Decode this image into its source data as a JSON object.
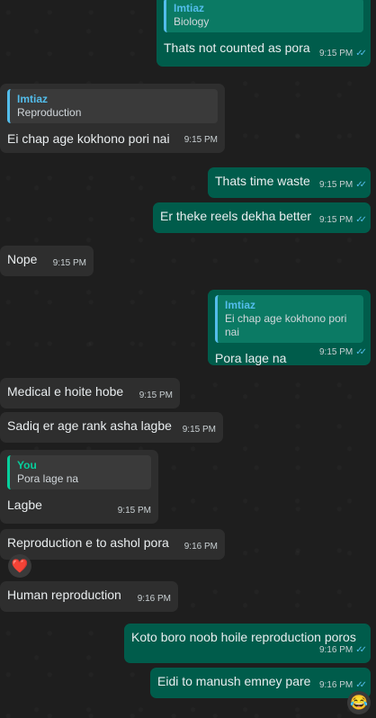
{
  "messages": [
    {
      "id": "m1",
      "dir": "out",
      "quote": {
        "name": "Imtiaz",
        "text": "Biology"
      },
      "text": "Thats not counted as pora",
      "time": "9:15 PM"
    },
    {
      "id": "m2",
      "dir": "in",
      "quote": {
        "name": "Imtiaz",
        "text": "Reproduction"
      },
      "text": "Ei chap age kokhono pori nai",
      "time": "9:15 PM"
    },
    {
      "id": "m3",
      "dir": "out",
      "text": "Thats time waste",
      "time": "9:15 PM"
    },
    {
      "id": "m4",
      "dir": "out",
      "text": "Er theke reels dekha better",
      "time": "9:15 PM"
    },
    {
      "id": "m5",
      "dir": "in",
      "text": "Nope",
      "time": "9:15 PM"
    },
    {
      "id": "m6",
      "dir": "out",
      "quote": {
        "name": "Imtiaz",
        "text": "Ei chap age kokhono pori nai"
      },
      "text": "Pora lage na",
      "time": "9:15 PM"
    },
    {
      "id": "m7",
      "dir": "in",
      "text": "Medical e hoite hobe",
      "time": "9:15 PM"
    },
    {
      "id": "m8",
      "dir": "in",
      "text": "Sadiq er age rank asha lagbe",
      "time": "9:15 PM"
    },
    {
      "id": "m9",
      "dir": "in",
      "quote": {
        "name": "You",
        "text": "Pora lage na"
      },
      "text": "Lagbe",
      "time": "9:15 PM"
    },
    {
      "id": "m10",
      "dir": "in",
      "text": "Reproduction e to ashol pora",
      "time": "9:16 PM"
    },
    {
      "id": "m11",
      "dir": "in",
      "text": "Human reproduction",
      "time": "9:16 PM"
    },
    {
      "id": "m12",
      "dir": "out",
      "text": "Koto boro noob hoile reproduction poros",
      "time": "9:16 PM"
    },
    {
      "id": "m13",
      "dir": "out",
      "text": "Eidi to manush emney pare",
      "time": "9:16 PM"
    }
  ],
  "reaction": "❤️",
  "emoji_button": "😂",
  "read_tick": "✓✓",
  "colors": {
    "incoming": "#2e2e2e",
    "outgoing": "#005c4b",
    "quote_name": "#53bdeb",
    "you_name": "#06cf9c",
    "background": "#1e1e1e"
  }
}
